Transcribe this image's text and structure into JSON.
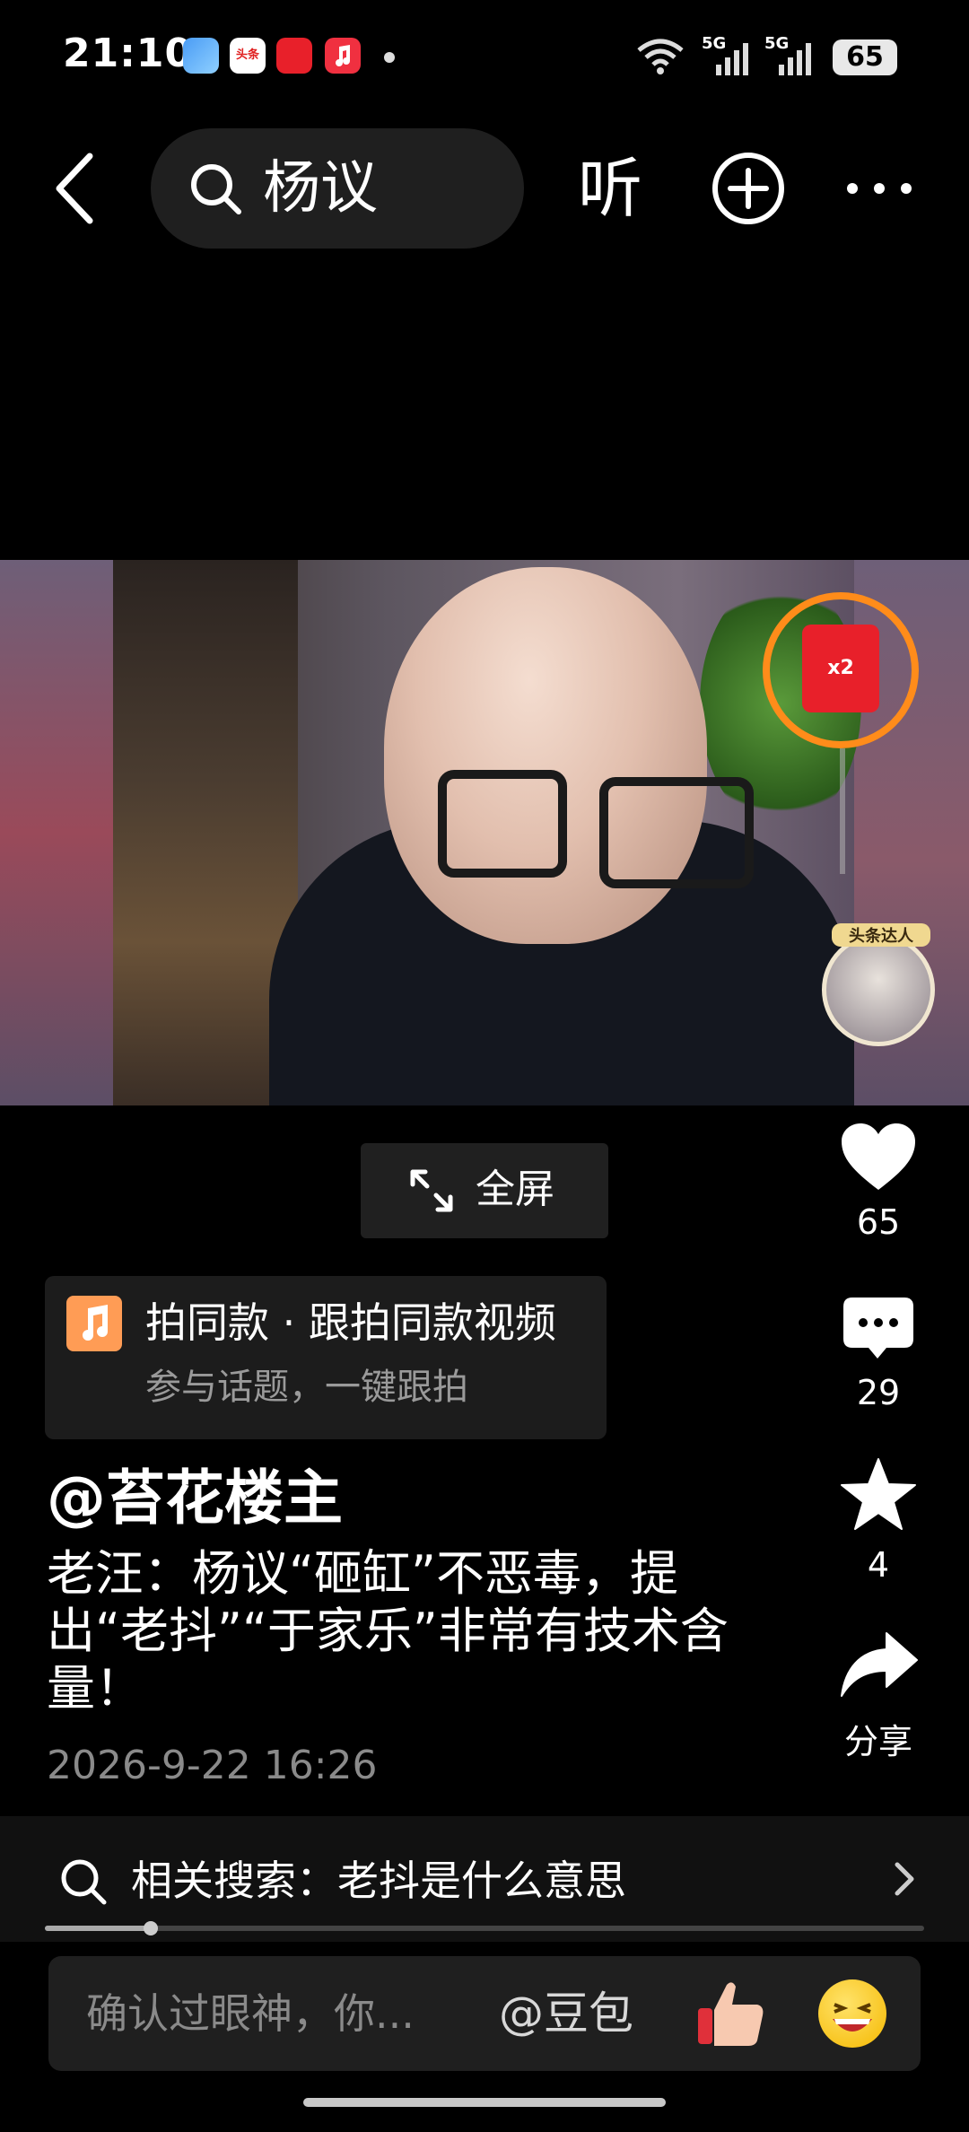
{
  "status_bar": {
    "time": "21:10",
    "signal1_label": "5G",
    "signal2_label": "5G",
    "battery": "65",
    "notif_toutiao": "头条"
  },
  "top_nav": {
    "search_query": "杨议",
    "listen_label": "听"
  },
  "video": {
    "red_packet_badge": "x2",
    "badge_label": "头条达人"
  },
  "fullscreen_label": "全屏",
  "actions": {
    "likes": "65",
    "comments": "29",
    "favorites": "4",
    "share_label": "分享"
  },
  "banner": {
    "title": "拍同款 · 跟拍同款视频",
    "subtitle": "参与话题，一键跟拍"
  },
  "post": {
    "author": "@苔花楼主",
    "title": "老汪：杨议“砸缸”不恶毒，提出“老抖”“于家乐”非常有技术含量！",
    "date": "2026-9-22 16:26"
  },
  "related_search": "相关搜索：老抖是什么意思",
  "progress": {
    "fraction": 0.12
  },
  "comment_input": {
    "placeholder": "确认过眼神，你...",
    "mention": "@豆包"
  },
  "colors": {
    "background": "#000000",
    "accent_orange": "#ff8c1a",
    "red_packet": "#e8202a",
    "music_icon": "#ff9c55"
  }
}
